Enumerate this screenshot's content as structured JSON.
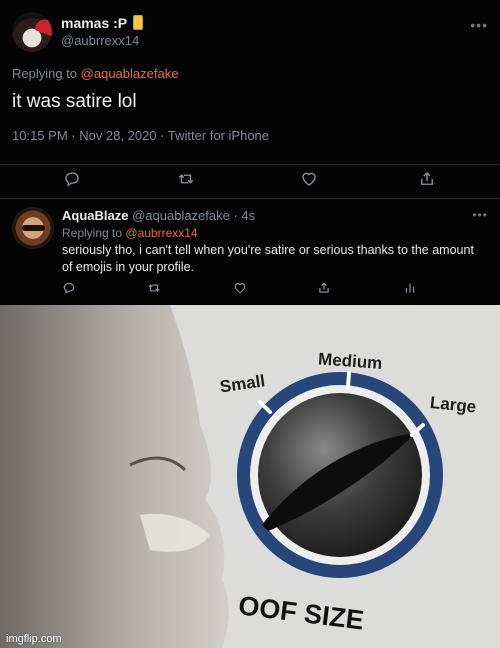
{
  "tweet1": {
    "name": "mamas :P",
    "name_emoji": "tropical-drink-icon",
    "handle": "@aubrrexx14",
    "replying_to_label": "Replying to",
    "replying_to_user": "@aquablazefake",
    "text": "it was satire lol",
    "meta": "10:15 PM · Nov 28, 2020 · Twitter for iPhone",
    "more": "•••"
  },
  "tweet2": {
    "name": "AquaBlaze",
    "handle_time": "@aquablazefake · 4s",
    "replying_to_label": "Replying to",
    "replying_to_user": "@aubrrexx14",
    "text": "seriously tho, i can't tell when you're satire or serious thanks to the amount of emojis in your profile.",
    "more": "•••"
  },
  "meme": {
    "dial_labels": {
      "small": "Small",
      "medium": "Medium",
      "large": "Large"
    },
    "caption": "OOF SIZE",
    "watermark": "imgflip.com"
  },
  "colors": {
    "background": "#000000",
    "mention": "#f06a46",
    "muted": "#7c8a96",
    "dial_ring": "#29467b"
  }
}
